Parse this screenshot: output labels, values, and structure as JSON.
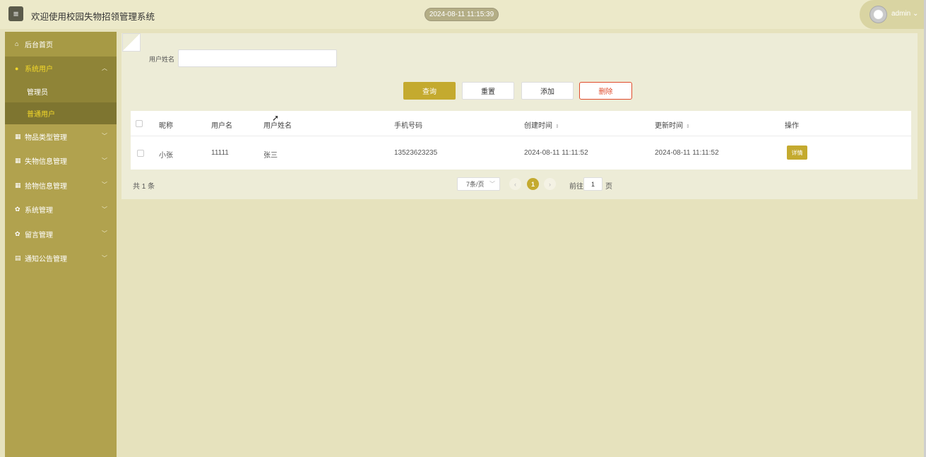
{
  "header": {
    "title": "欢迎使用校园失物招领管理系统",
    "datetime": "2024-08-11 11:15:39",
    "username": "admin",
    "username_caret": "⌄"
  },
  "sidebar": {
    "items": [
      {
        "label": "后台首页",
        "icon": "home-icon"
      },
      {
        "label": "系统用户",
        "icon": "user-icon",
        "expanded": true,
        "children": [
          {
            "label": "管理员"
          },
          {
            "label": "普通用户",
            "active": true
          }
        ]
      },
      {
        "label": "物品类型管理",
        "icon": "grid-icon"
      },
      {
        "label": "失物信息管理",
        "icon": "grid-icon"
      },
      {
        "label": "拾物信息管理",
        "icon": "grid-icon"
      },
      {
        "label": "系统管理",
        "icon": "gear-icon"
      },
      {
        "label": "留言管理",
        "icon": "gear-icon"
      },
      {
        "label": "通知公告管理",
        "icon": "doc-icon"
      }
    ]
  },
  "search": {
    "label": "用户姓名",
    "value": "",
    "placeholder": ""
  },
  "toolbar": {
    "query_label": "查询",
    "reset_label": "重置",
    "add_label": "添加",
    "delete_label": "删除"
  },
  "table": {
    "columns": [
      "昵称",
      "用户名",
      "用户姓名",
      "手机号码",
      "创建时间",
      "更新时间",
      "操作"
    ],
    "rows": [
      {
        "nickname": "小张",
        "username": "11111",
        "realname": "张三",
        "phone": "13523623235",
        "created": "2024-08-11 11:11:52",
        "updated": "2024-08-11 11:11:52",
        "action": "详情"
      }
    ]
  },
  "pagination": {
    "total_text": "共 1 条",
    "page_size": "7条/页",
    "current_page": "1",
    "goto_label": "前往",
    "goto_value": "1",
    "goto_suffix": "页"
  },
  "colors": {
    "accent": "#c4aa2f",
    "sidebar": "#b1a24e",
    "active_text": "#f3d82a",
    "danger": "#e04b2b"
  }
}
